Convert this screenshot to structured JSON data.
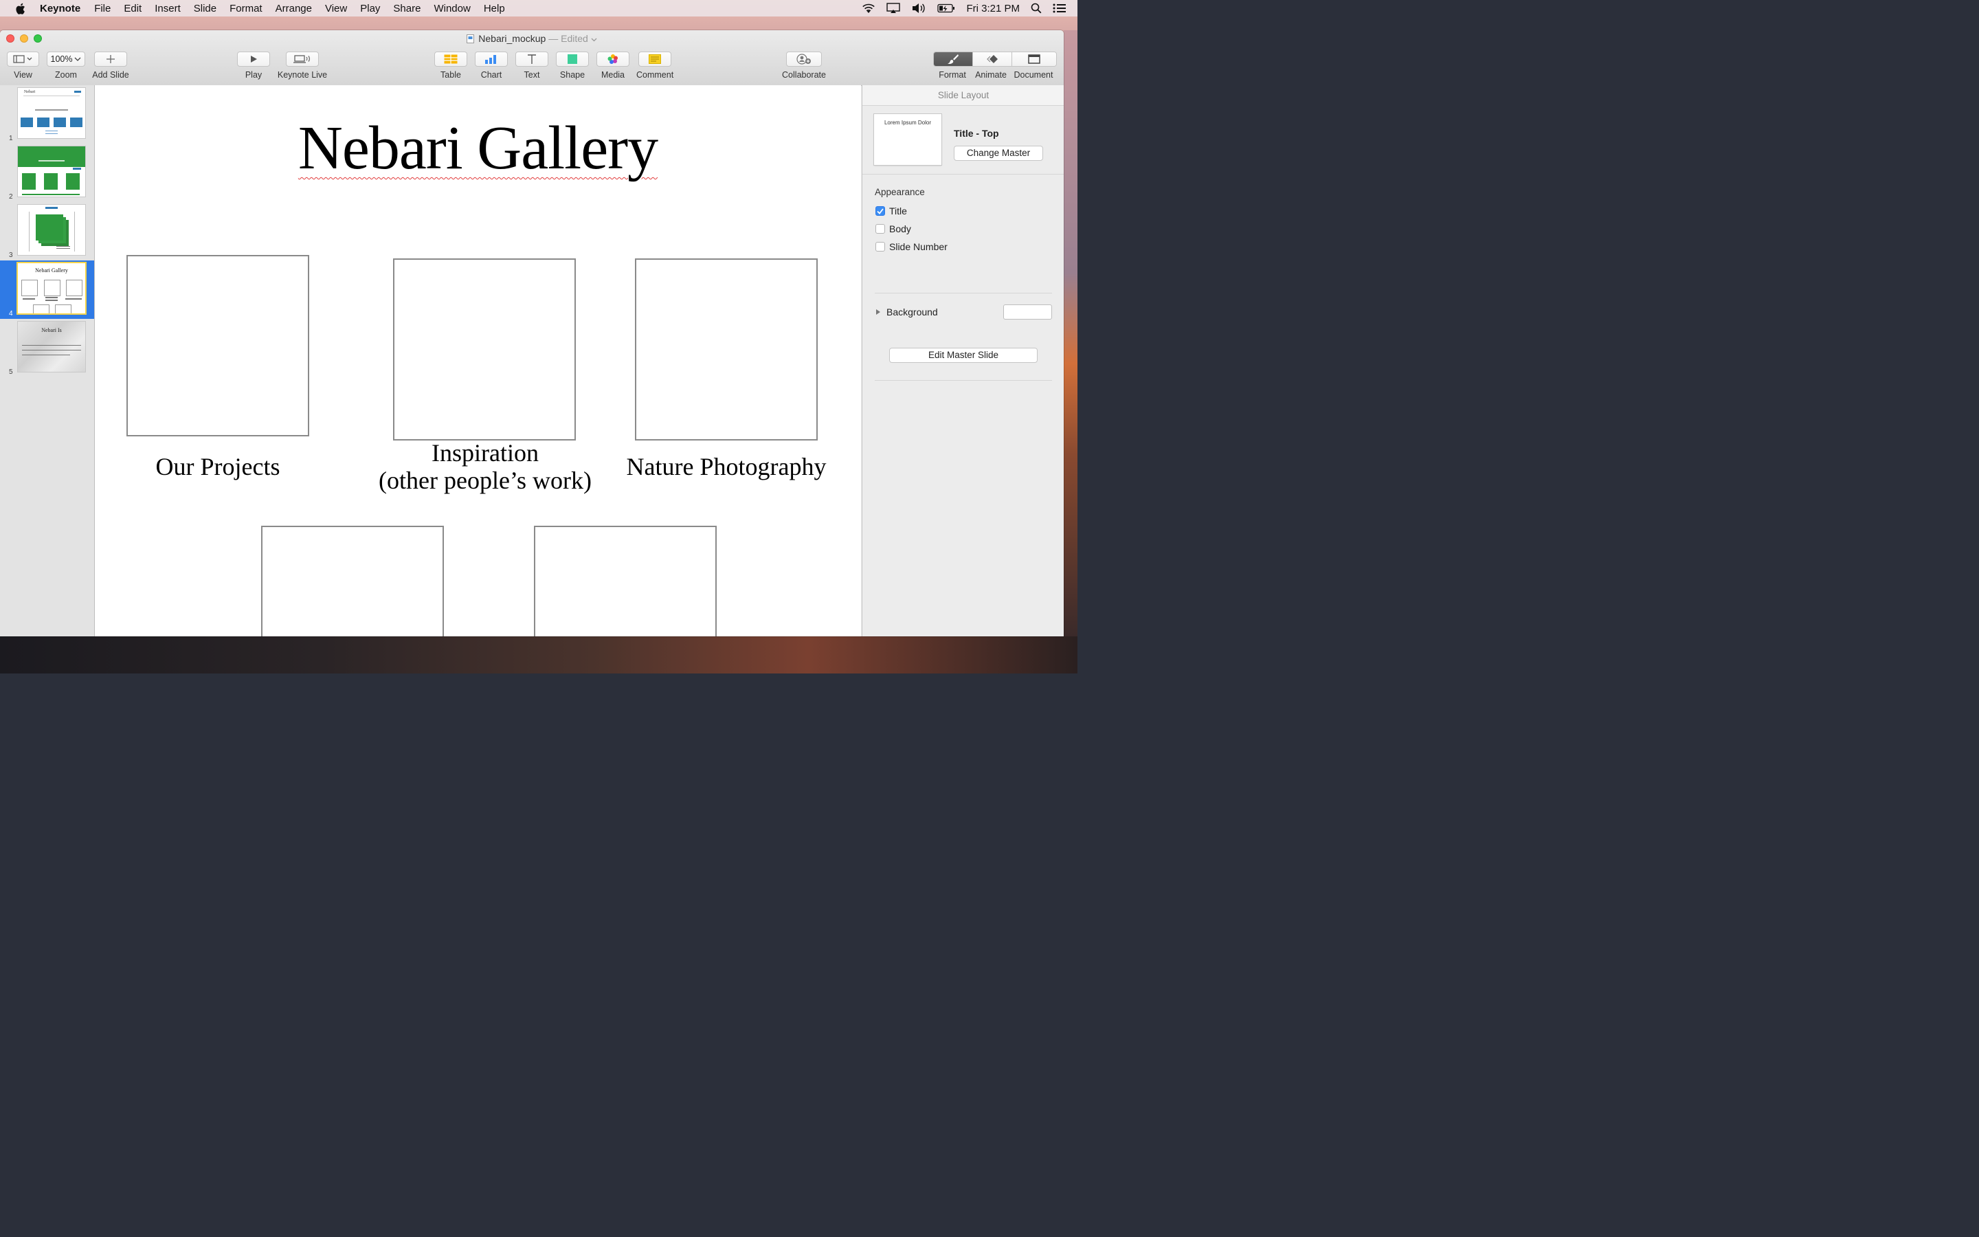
{
  "menubar": {
    "app": "Keynote",
    "items": [
      "File",
      "Edit",
      "Insert",
      "Slide",
      "Format",
      "Arrange",
      "View",
      "Play",
      "Share",
      "Window",
      "Help"
    ],
    "clock": "Fri 3:21 PM"
  },
  "window": {
    "doc_title": "Nebari_mockup",
    "edited": "— Edited"
  },
  "toolbar": {
    "view_label": "View",
    "zoom_value": "100%",
    "zoom_label": "Zoom",
    "add_slide_label": "Add Slide",
    "play_label": "Play",
    "keynote_live_label": "Keynote Live",
    "table_label": "Table",
    "chart_label": "Chart",
    "text_label": "Text",
    "shape_label": "Shape",
    "media_label": "Media",
    "comment_label": "Comment",
    "collaborate_label": "Collaborate",
    "format_label": "Format",
    "animate_label": "Animate",
    "document_label": "Document"
  },
  "navigator": {
    "slides": [
      {
        "number": "1",
        "title": "Nebari"
      },
      {
        "number": "2",
        "title": ""
      },
      {
        "number": "3",
        "title": ""
      },
      {
        "number": "4",
        "title": "Nebari Gallery"
      },
      {
        "number": "5",
        "title": "Nebari Is"
      }
    ],
    "selected": 4
  },
  "slide": {
    "title": "Nebari Gallery",
    "labels": {
      "projects": "Our Projects",
      "inspiration_1": "Inspiration",
      "inspiration_2": "(other people’s work)",
      "nature": "Nature Photography"
    }
  },
  "inspector": {
    "header": "Slide Layout",
    "master_thumb_text": "Lorem Ipsum Dolor",
    "master_name": "Title - Top",
    "change_master": "Change Master",
    "appearance_title": "Appearance",
    "title_checkbox": "Title",
    "body_checkbox": "Body",
    "slide_number_checkbox": "Slide Number",
    "background_label": "Background",
    "edit_master": "Edit Master Slide",
    "title_checked": true,
    "body_checked": false,
    "slide_number_checked": false
  },
  "colors": {
    "selection": "#2f7ae5",
    "thumb_highlight": "#f6d44a",
    "checkbox_on": "#3b8df3"
  }
}
